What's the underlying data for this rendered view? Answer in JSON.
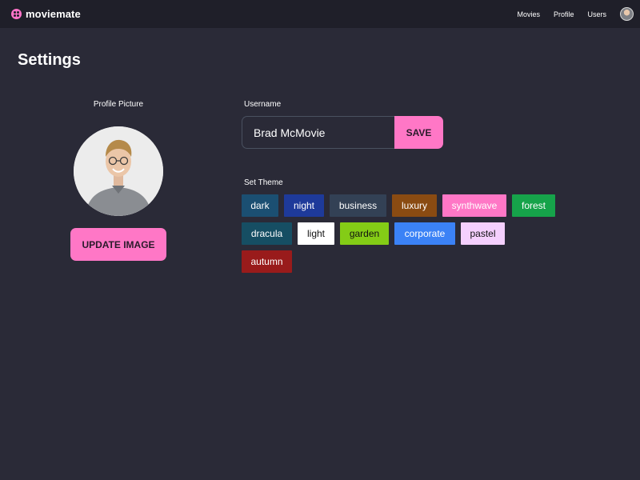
{
  "navbar": {
    "brand_name": "moviemate",
    "links": [
      "Movies",
      "Profile",
      "Users"
    ]
  },
  "page": {
    "title": "Settings"
  },
  "profile": {
    "picture_label": "Profile Picture",
    "update_button_label": "UPDATE IMAGE"
  },
  "username": {
    "label": "Username",
    "value": "Brad McMovie",
    "save_button_label": "SAVE"
  },
  "theme": {
    "label": "Set Theme",
    "options": [
      {
        "name": "dark",
        "bg": "#1b4f72",
        "fg": "#ffffff"
      },
      {
        "name": "night",
        "bg": "#1e3a9a",
        "fg": "#ffffff"
      },
      {
        "name": "business",
        "bg": "#334155",
        "fg": "#ffffff"
      },
      {
        "name": "luxury",
        "bg": "#8a4b12",
        "fg": "#ffffff"
      },
      {
        "name": "synthwave",
        "bg": "#ff77c6",
        "fg": "#ffffff"
      },
      {
        "name": "forest",
        "bg": "#16a34a",
        "fg": "#ffffff"
      },
      {
        "name": "dracula",
        "bg": "#164e63",
        "fg": "#ffffff"
      },
      {
        "name": "light",
        "bg": "#ffffff",
        "fg": "#111111"
      },
      {
        "name": "garden",
        "bg": "#84cc16",
        "fg": "#111111"
      },
      {
        "name": "corporate",
        "bg": "#3b82f6",
        "fg": "#ffffff"
      },
      {
        "name": "pastel",
        "bg": "#f5d0fe",
        "fg": "#111111"
      },
      {
        "name": "autumn",
        "bg": "#991b1b",
        "fg": "#ffffff"
      }
    ]
  },
  "colors": {
    "background": "#2a2a37",
    "navbar": "#1f1f29",
    "accent": "#ff77c6"
  }
}
